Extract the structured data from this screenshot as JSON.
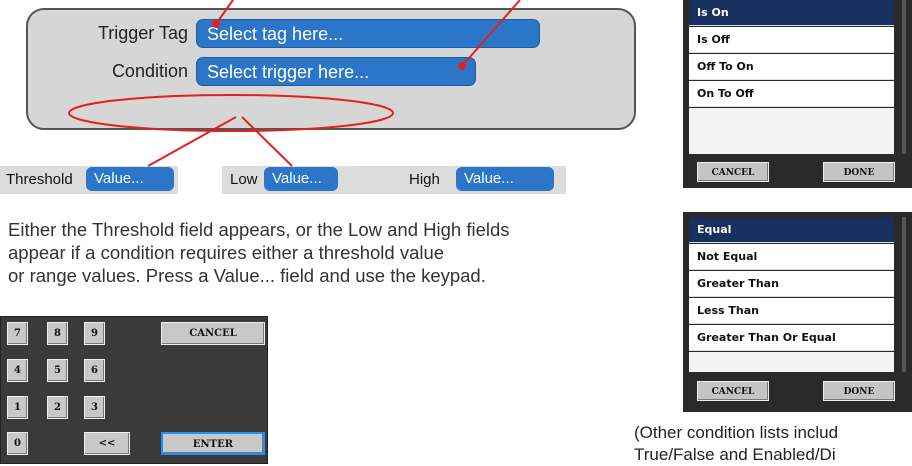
{
  "trigger_panel": {
    "trigger_tag_label": "Trigger Tag",
    "trigger_tag_value": "Select tag here...",
    "condition_label": "Condition",
    "condition_value": "Select trigger here..."
  },
  "value_fields": {
    "threshold_label": "Threshold",
    "threshold_value": "Value...",
    "low_label": "Low",
    "low_value": "Value...",
    "high_label": "High",
    "high_value": "Value..."
  },
  "description": {
    "line1": "Either the Threshold field appears, or the Low and High fields",
    "line2": "appear if a condition requires either a threshold value",
    "line3": "or range values. Press a Value... field and use the keypad."
  },
  "keypad": {
    "keys": [
      "7",
      "8",
      "9",
      "4",
      "5",
      "6",
      "1",
      "2",
      "3",
      "0",
      "<<"
    ],
    "cancel_label": "CANCEL",
    "enter_label": "ENTER"
  },
  "boolean_list": {
    "items": [
      "Is On",
      "Is Off",
      "Off To On",
      "On To Off"
    ],
    "selected": "Is On",
    "cancel_label": "CANCEL",
    "done_label": "DONE"
  },
  "compare_list": {
    "items": [
      "Equal",
      "Not Equal",
      "Greater Than",
      "Less Than",
      "Greater Than Or Equal"
    ],
    "selected": "Equal",
    "cancel_label": "CANCEL",
    "done_label": "DONE"
  },
  "footnote": {
    "line1": "(Other condition lists includ",
    "line2": "True/False and Enabled/Di"
  },
  "colors": {
    "accent_blue": "#2b76c9",
    "annotation_red": "#e2201c",
    "selected_navy": "#17305e"
  }
}
